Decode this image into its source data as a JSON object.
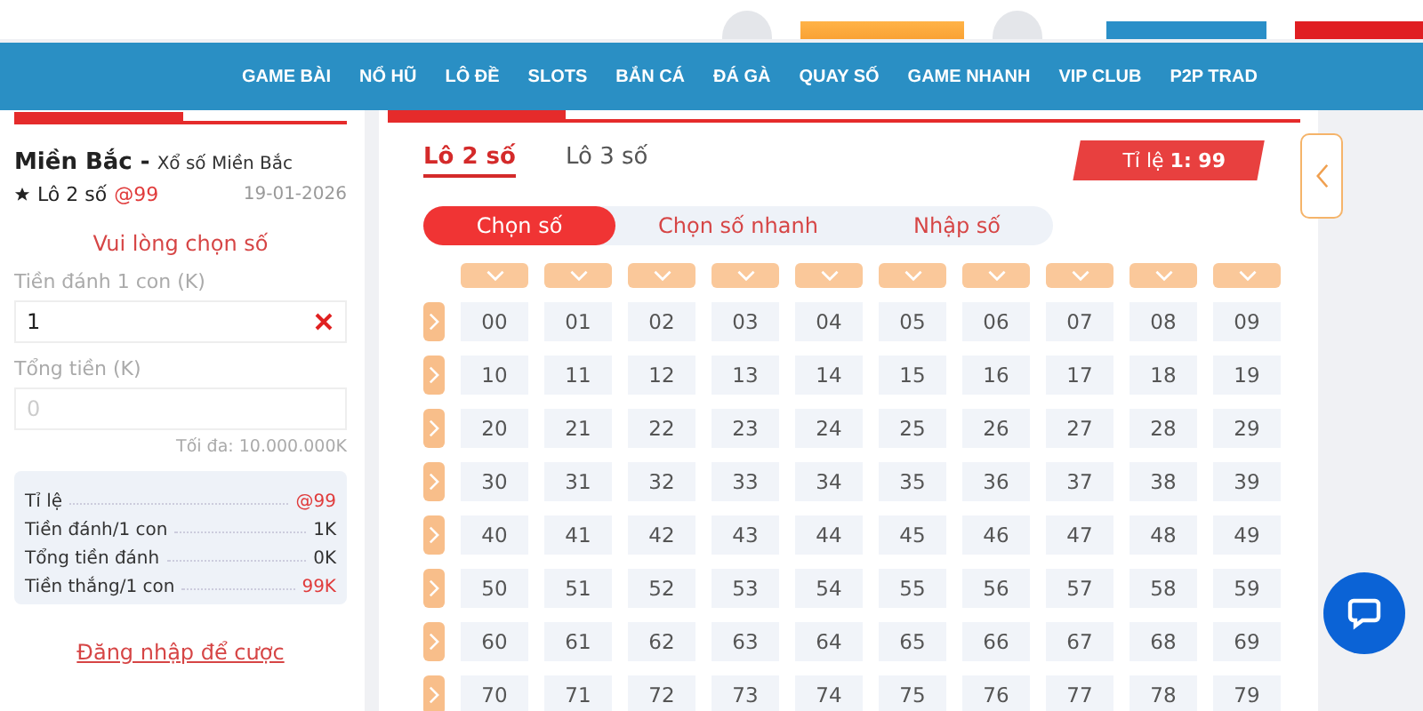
{
  "nav": {
    "items": [
      "GAME BÀI",
      "NỔ HŨ",
      "LÔ ĐỀ",
      "SLOTS",
      "BẮN CÁ",
      "ĐÁ GÀ",
      "QUAY SỐ",
      "GAME NHANH",
      "VIP CLUB",
      "P2P TRAD"
    ]
  },
  "bet_panel": {
    "region": "Miền Bắc -",
    "game": "Xổ số Miền Bắc",
    "bet_type": "Lô 2 số",
    "odds": "@99",
    "date": "19-01-2026",
    "prompt": "Vui lòng chọn số",
    "stake_label": "Tiền đánh 1 con (K)",
    "stake_value": "1",
    "total_label": "Tổng tiền (K)",
    "total_placeholder": "0",
    "max_note": "Tối đa: 10.000.000K",
    "summary": [
      {
        "label": "Tỉ lệ",
        "value": "@99",
        "highlight": true
      },
      {
        "label": "Tiền đánh/1 con",
        "value": "1K",
        "highlight": false
      },
      {
        "label": "Tổng tiền đánh",
        "value": "0K",
        "highlight": false
      },
      {
        "label": "Tiền thắng/1 con",
        "value": "99K",
        "highlight": true
      }
    ],
    "login_link": "Đăng nhập để cược"
  },
  "main": {
    "tabs": [
      {
        "label": "Lô 2 số",
        "selected": true
      },
      {
        "label": "Lô 3 số",
        "selected": false
      }
    ],
    "odds_badge": "Tỉ lệ **1: 99**",
    "modes": [
      {
        "label": "Chọn số",
        "selected": true
      },
      {
        "label": "Chọn số nhanh",
        "selected": false
      },
      {
        "label": "Nhập số",
        "selected": false
      }
    ],
    "grid": {
      "rows": [
        [
          "00",
          "01",
          "02",
          "03",
          "04",
          "05",
          "06",
          "07",
          "08",
          "09"
        ],
        [
          "10",
          "11",
          "12",
          "13",
          "14",
          "15",
          "16",
          "17",
          "18",
          "19"
        ],
        [
          "20",
          "21",
          "22",
          "23",
          "24",
          "25",
          "26",
          "27",
          "28",
          "29"
        ],
        [
          "30",
          "31",
          "32",
          "33",
          "34",
          "35",
          "36",
          "37",
          "38",
          "39"
        ],
        [
          "40",
          "41",
          "42",
          "43",
          "44",
          "45",
          "46",
          "47",
          "48",
          "49"
        ],
        [
          "50",
          "51",
          "52",
          "53",
          "54",
          "55",
          "56",
          "57",
          "58",
          "59"
        ],
        [
          "60",
          "61",
          "62",
          "63",
          "64",
          "65",
          "66",
          "67",
          "68",
          "69"
        ],
        [
          "70",
          "71",
          "72",
          "73",
          "74",
          "75",
          "76",
          "77",
          "78",
          "79"
        ]
      ]
    }
  }
}
